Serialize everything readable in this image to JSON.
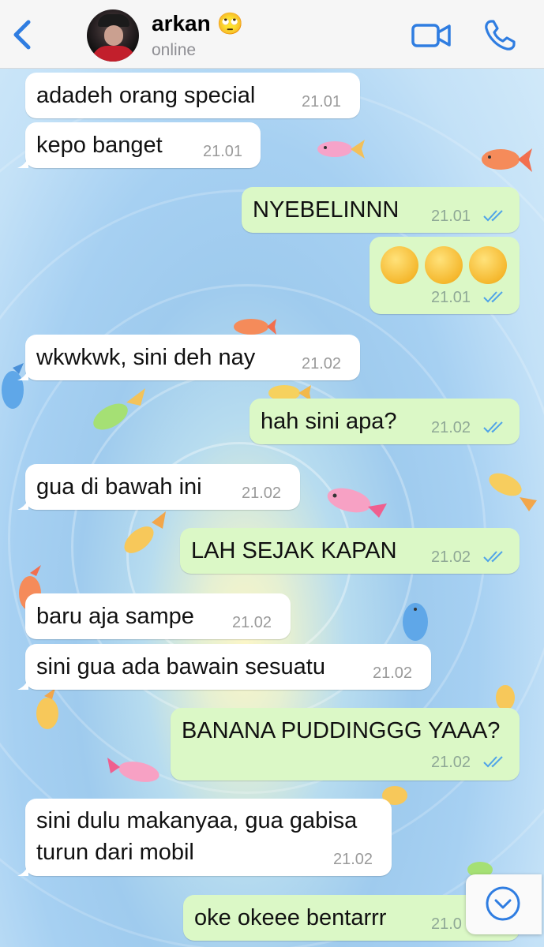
{
  "header": {
    "contact_name": "arkan",
    "contact_status": "online",
    "name_emoji": "🙄"
  },
  "icons": {
    "back": "chevron-left-icon",
    "video": "video-camera-icon",
    "call": "phone-icon",
    "scroll_down": "chevron-down-circle-icon"
  },
  "colors": {
    "accent": "#2f7de1",
    "incoming_bubble": "#ffffff",
    "outgoing_bubble": "#dbf8c6",
    "read_ticks": "#4fa3e8"
  },
  "messages": [
    {
      "dir": "in",
      "text": "adadeh orang special",
      "time": "21.01"
    },
    {
      "dir": "in",
      "text": "kepo banget",
      "time": "21.01"
    },
    {
      "dir": "out",
      "text": "NYEBELINNN",
      "time": "21.01"
    },
    {
      "dir": "out",
      "text": "😒 😒 😒",
      "time": "21.01"
    },
    {
      "dir": "in",
      "text": "wkwkwk, sini deh nay",
      "time": "21.02"
    },
    {
      "dir": "out",
      "text": "hah sini apa?",
      "time": "21.02"
    },
    {
      "dir": "in",
      "text": "gua di bawah ini",
      "time": "21.02"
    },
    {
      "dir": "out",
      "text": "LAH SEJAK KAPAN",
      "time": "21.02"
    },
    {
      "dir": "in",
      "text": "baru aja sampe",
      "time": "21.02"
    },
    {
      "dir": "in",
      "text": "sini gua ada bawain sesuatu",
      "time": "21.02"
    },
    {
      "dir": "out",
      "text": "BANANA PUDDINGGG YAAA?",
      "time": "21.02"
    },
    {
      "dir": "in",
      "text": "sini dulu makanyaa, gua gabisa\nturun dari mobil",
      "time": "21.02"
    },
    {
      "dir": "out",
      "text": "oke okeee bentarrr",
      "time": "21.0"
    }
  ]
}
